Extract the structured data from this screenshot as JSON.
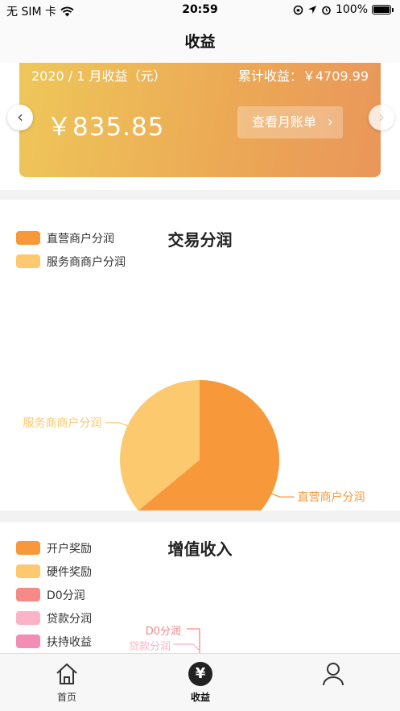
{
  "status_bar": {
    "carrier": "无 SIM 卡",
    "time": "20:59",
    "battery": "100%"
  },
  "header": {
    "title": "收益"
  },
  "earnings_card": {
    "month_label": "2020 / 1 月收益（元）",
    "total_label": "累计收益：￥4709.99",
    "amount": "￥835.85",
    "bill_button": "查看月账单"
  },
  "transaction_chart": {
    "title": "交易分润",
    "legend": [
      {
        "label": "直营商户分润",
        "color": "#f7993a"
      },
      {
        "label": "服务商商户分润",
        "color": "#fcc96e"
      }
    ]
  },
  "value_added_chart": {
    "title": "增值收入",
    "legend": [
      {
        "label": "开户奖励",
        "color": "#f7993a"
      },
      {
        "label": "硬件奖励",
        "color": "#fcc96e"
      },
      {
        "label": "D0分润",
        "color": "#f58a86"
      },
      {
        "label": "贷款分润",
        "color": "#fdb3c7"
      },
      {
        "label": "扶持收益",
        "color": "#f48db4"
      }
    ],
    "partial_labels": [
      "D0分润",
      "贷款分润"
    ]
  },
  "chart_data": [
    {
      "type": "pie",
      "title": "交易分润",
      "categories": [
        "直营商户分润",
        "服务商商户分润"
      ],
      "values": [
        64,
        36
      ],
      "colors": [
        "#f7993a",
        "#fcc96e"
      ],
      "legend_position": "top-left"
    },
    {
      "type": "pie",
      "title": "增值收入",
      "categories": [
        "开户奖励",
        "硬件奖励",
        "D0分润",
        "贷款分润",
        "扶持收益"
      ],
      "colors": [
        "#f7993a",
        "#fcc96e",
        "#f58a86",
        "#fdb3c7",
        "#f48db4"
      ],
      "legend_position": "top-left"
    }
  ],
  "tabs": [
    {
      "label": "首页",
      "icon": "home-icon"
    },
    {
      "label": "收益",
      "icon": "yen-icon"
    },
    {
      "label": "",
      "icon": "user-icon"
    }
  ]
}
